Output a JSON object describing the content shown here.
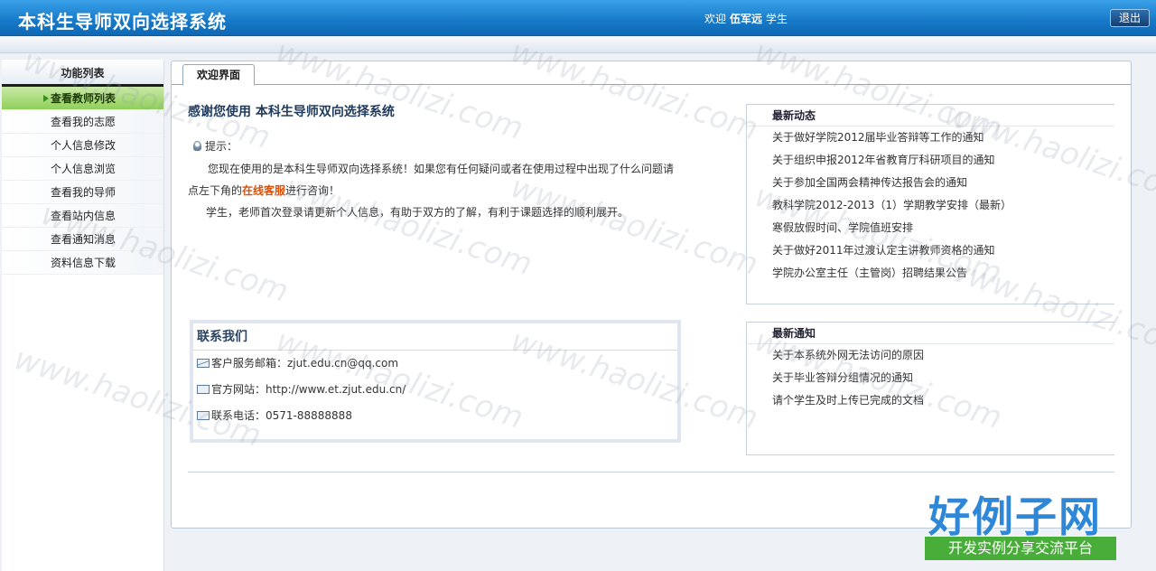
{
  "header": {
    "title": "本科生导师双向选择系统",
    "welcome_prefix": "欢迎",
    "user_name": "伍军远",
    "role": "学生",
    "logout_label": "退出"
  },
  "sidebar": {
    "title": "功能列表",
    "items": [
      {
        "label": "查看教师列表"
      },
      {
        "label": "查看我的志愿"
      },
      {
        "label": "个人信息修改"
      },
      {
        "label": "个人信息浏览"
      },
      {
        "label": "查看我的导师"
      },
      {
        "label": "查看站内信息"
      },
      {
        "label": "查看通知消息"
      },
      {
        "label": "资料信息下载"
      }
    ]
  },
  "main": {
    "tab_label": "欢迎界面",
    "intro_title": "感谢您使用  本科生导师双向选择系统",
    "tip_label": "提示：",
    "tip_text_1": "您现在使用的是本科生导师双向选择系统！如果您有任何疑问或者在使用过程中出现了什么问题请点左下角的",
    "tip_link": "在线客服",
    "tip_text_2": "进行咨询！",
    "tip_text_3": "学生，老师首次登录请更新个人信息，有助于双方的了解，有利于课题选择的顺利展开。"
  },
  "contact": {
    "title": "联系我们",
    "email": "客户服务邮箱：zjut.edu.cn@qq.com",
    "website": "官方网站：http://www.et.zjut.edu.cn/",
    "phone": "联系电话：0571-88888888"
  },
  "news": {
    "title": "最新动态",
    "items": [
      "关于做好学院2012届毕业答辩等工作的通知",
      "关于组织申报2012年省教育厅科研项目的通知",
      "关于参加全国两会精神传达报告会的通知",
      "教科学院2012-2013（1）学期教学安排（最新）",
      "寒假放假时间、学院值班安排",
      "关于做好2011年过渡认定主讲教师资格的通知",
      "学院办公室主任（主管岗）招聘结果公告"
    ]
  },
  "notices": {
    "title": "最新通知",
    "items": [
      "关于本系统外网无法访问的原因",
      "关于毕业答辩分组情况的通知",
      "请个学生及时上传已完成的文档"
    ]
  },
  "watermark": {
    "text": "www.haolizi.com",
    "brand_main": "好例子网",
    "brand_sub": "开发实例分享交流平台"
  },
  "colors": {
    "header": "#1679c8",
    "active_menu": "#8fcf5a",
    "link_highlight": "#d9500a"
  }
}
